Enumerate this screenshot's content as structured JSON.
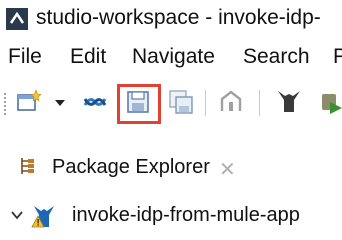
{
  "window": {
    "title": "studio-workspace - invoke-idp-"
  },
  "menu": {
    "items": [
      {
        "label": "File"
      },
      {
        "label": "Edit"
      },
      {
        "label": "Navigate"
      },
      {
        "label": "Search"
      },
      {
        "label": "P"
      }
    ]
  },
  "toolbar": {
    "buttons": [
      {
        "icon": "new-wizard-icon"
      },
      {
        "icon": "dropdown-arrow-icon"
      },
      {
        "icon": "link-icon"
      },
      {
        "icon": "save-icon",
        "highlighted": true
      },
      {
        "icon": "save-all-icon"
      },
      {
        "icon": "anypoint-icon"
      },
      {
        "icon": "mule-icon"
      },
      {
        "icon": "run-icon"
      }
    ],
    "highlight_color": "#e04232"
  },
  "view": {
    "tab_label": "Package Explorer",
    "close_glyph": "✕"
  },
  "tree": {
    "project_label": "invoke-idp-from-mule-app"
  }
}
